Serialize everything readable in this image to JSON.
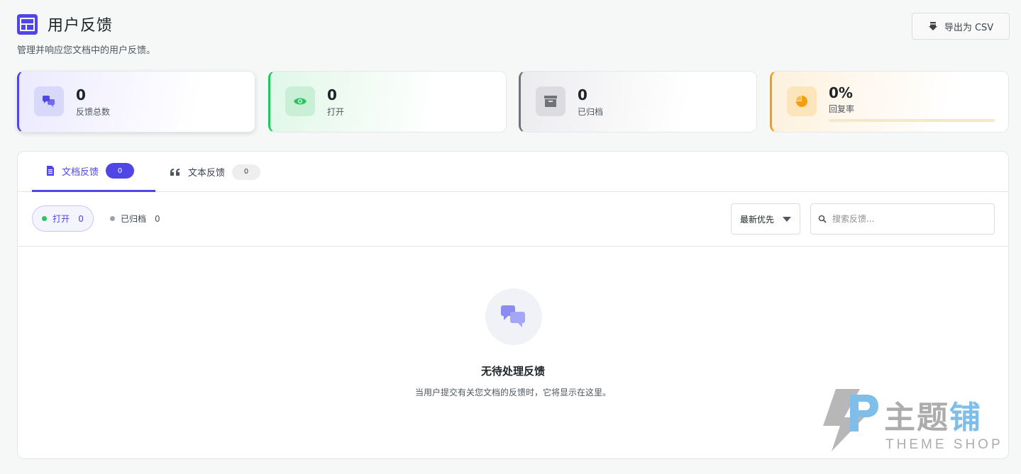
{
  "header": {
    "title": "用户反馈",
    "subtitle": "管理并响应您文档中的用户反馈。",
    "export_label": "导出为 CSV"
  },
  "stats": [
    {
      "value": "0",
      "label": "反馈总数",
      "icon": "chat-bubbles-icon",
      "accent": "#4f46e5"
    },
    {
      "value": "0",
      "label": "打开",
      "icon": "eye-icon",
      "accent": "#22c55e"
    },
    {
      "value": "0",
      "label": "已归档",
      "icon": "archive-icon",
      "accent": "#71717a"
    },
    {
      "value": "0%",
      "label": "回复率",
      "icon": "pie-chart-icon",
      "accent": "#f59e0b",
      "progress": 0
    }
  ],
  "tabs": [
    {
      "label": "文档反馈",
      "count": "0",
      "icon": "document-icon",
      "active": true
    },
    {
      "label": "文本反馈",
      "count": "0",
      "icon": "quote-icon",
      "active": false
    }
  ],
  "filters": {
    "status": [
      {
        "label": "打开",
        "count": "0",
        "active": true
      },
      {
        "label": "已归档",
        "count": "0",
        "active": false
      }
    ],
    "sort_selected": "最新优先",
    "search_placeholder": "搜索反馈..."
  },
  "empty_state": {
    "title": "无待处理反馈",
    "text": "当用户提交有关您文档的反馈时，它将显示在这里。",
    "icon": "chat-bubbles-icon"
  },
  "watermark": {
    "main_gray": "主题",
    "main_blue": "铺",
    "sub": "THEME SHOP"
  }
}
